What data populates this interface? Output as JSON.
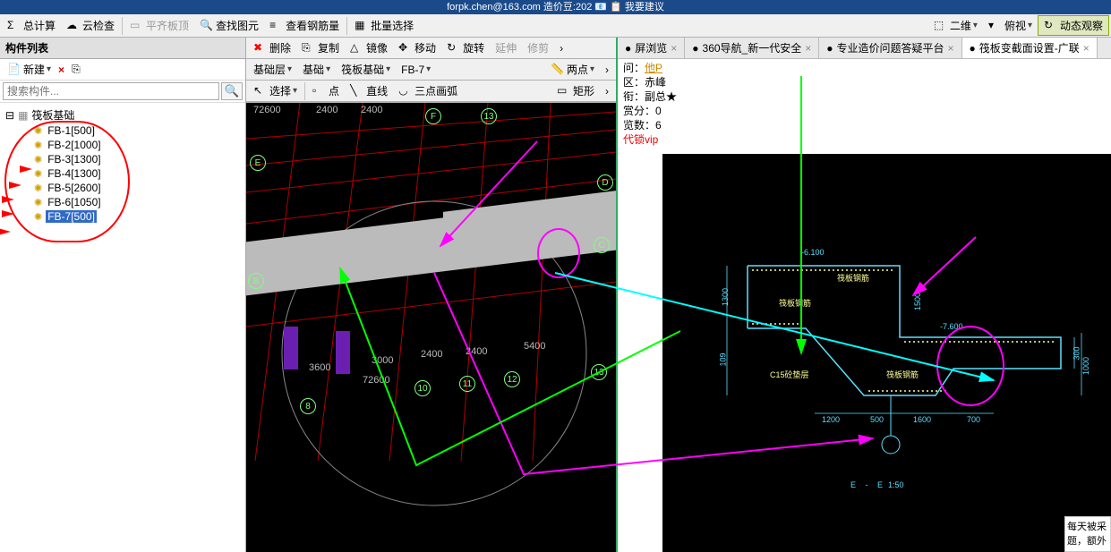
{
  "title_strip": "forpk.chen@163.com   造价豆:202   📧   📋 我要建议",
  "toolbar_top": {
    "calc": "总计算",
    "cloud_check": "云检查",
    "flat_slab": "平齐板顶",
    "find_elem": "查找图元",
    "view_rebar": "查看钢筋量",
    "batch_sel": "批量选择",
    "view3d": "二维",
    "view_angle": "俯视",
    "dynamic": "动态观察"
  },
  "panel": {
    "title": "构件列表",
    "new": "新建",
    "search_ph": "搜索构件...",
    "root": "筏板基础",
    "items": [
      "FB-1[500]",
      "FB-2[1000]",
      "FB-3[1300]",
      "FB-4[1300]",
      "FB-5[2600]",
      "FB-6[1050]",
      "FB-7[500]"
    ],
    "selected_index": 6
  },
  "center_tb": {
    "row1": {
      "del": "删除",
      "copy": "复制",
      "mirror": "镜像",
      "move": "移动",
      "rotate": "旋转",
      "extend": "延伸",
      "trim": "修剪"
    },
    "row2": {
      "floor": "基础层",
      "type": "基础",
      "sub": "筏板基础",
      "item": "FB-7",
      "mode": "两点"
    },
    "row3": {
      "select": "选择",
      "point": "点",
      "line": "直线",
      "arc": "三点画弧",
      "rect": "矩形"
    }
  },
  "viewport": {
    "dims_top": [
      "72600",
      "2400",
      "2400"
    ],
    "axis_top": [
      "F",
      "13"
    ],
    "axis_side": [
      "E",
      "D",
      "C",
      "B"
    ],
    "dims_bottom": [
      "3600",
      "3000",
      "2400",
      "2400",
      "5400"
    ],
    "axis_bottom": [
      "8",
      "72600",
      "10",
      "11",
      "12",
      "13"
    ]
  },
  "browser": {
    "tabs": [
      {
        "label": "屏浏览"
      },
      {
        "label": "360导航_新一代安全"
      },
      {
        "label": "专业造价问题答疑平台"
      },
      {
        "label": "筏板变截面设置-广联"
      }
    ],
    "active": 3
  },
  "meta": {
    "from_l": "问：",
    "from_v": "他P",
    "area_l": "区：",
    "area_v": "赤峰",
    "title_l": "衔：",
    "title_v": "副总★",
    "reward_l": "赏分：",
    "reward_v": "0",
    "views_l": "览数：",
    "views_v": "6",
    "vip": "代锁vip"
  },
  "drawing": {
    "lvl1": "-6.100",
    "lvl2": "-7.600",
    "t1": "筏板钢筋",
    "t2": "筏板钢筋",
    "t3": "筏板钢筋",
    "t4": "C15砼垫层",
    "d_left": "1300",
    "d_left2": "109",
    "d_right": "1500",
    "d_right2": "300",
    "d_right3": "1000",
    "d_b1": "1200",
    "d_b2": "500",
    "d_b3": "1600",
    "d_b4": "700",
    "section": "E - E",
    "scale": "1:50"
  },
  "notice": "每天被采题，额外"
}
